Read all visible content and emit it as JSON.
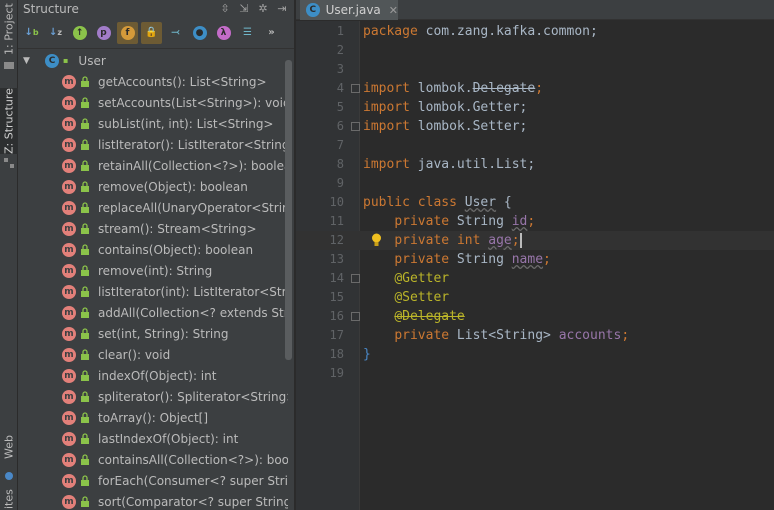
{
  "left_strip": {
    "project_tab": "1: Project",
    "structure_tab": "Z: Structure",
    "web_tab": "Web",
    "bottom_tab": "ites"
  },
  "structure": {
    "title": "Structure",
    "root": "User",
    "members": [
      "getAccounts(): List<String>",
      "setAccounts(List<String>): void",
      "subList(int, int): List<String>",
      "listIterator(): ListIterator<String>",
      "retainAll(Collection<?>): boolean",
      "remove(Object): boolean",
      "replaceAll(UnaryOperator<String>",
      "stream(): Stream<String>",
      "contains(Object): boolean",
      "remove(int): String",
      "listIterator(int): ListIterator<String:",
      "addAll(Collection<? extends String",
      "set(int, String): String",
      "clear(): void",
      "indexOf(Object): int",
      "spliterator(): Spliterator<String>",
      "toArray(): Object[]",
      "lastIndexOf(Object): int",
      "containsAll(Collection<?>): boolea",
      "forEach(Consumer<? super String",
      "sort(Comparator<? super String>):"
    ]
  },
  "editor": {
    "tab_label": "User.java",
    "line_numbers": [
      "1",
      "2",
      "3",
      "4",
      "5",
      "6",
      "7",
      "8",
      "9",
      "10",
      "11",
      "12",
      "13",
      "14",
      "15",
      "16",
      "17",
      "18",
      "19"
    ],
    "code": {
      "l1_kw": "package",
      "l1_rest": " com.zang.kafka.common;",
      "import_kw": "import",
      "l4_pkg": " lombok.",
      "l4_name": "Delegate",
      "l4_end": ";",
      "l5_rest": " lombok.Getter;",
      "l6_rest": " lombok.Setter;",
      "l8_rest": " java.util.List;",
      "l10_kw": "public class",
      "l10_name": "User",
      "l10_end": " {",
      "private_kw": "private",
      "l11_type": " String ",
      "l11_field": "id",
      "l11_end": ";",
      "l12_type": "int",
      "l12_field": "age",
      "l12_end": ";",
      "l13_type": " String ",
      "l13_field": "name",
      "l13_end": ";",
      "l14_ann": "@Getter",
      "l15_ann": "@Setter",
      "l16_ann": "@Delegate",
      "l17_type": " List<String> ",
      "l17_field": "accounts",
      "l17_end": ";",
      "l18": "}"
    }
  },
  "colors": {
    "keyword": "#cc7832",
    "annotation": "#bbb529",
    "field": "#9876aa",
    "method_icon": "#e3807a",
    "class_icon": "#3d8ec6"
  }
}
